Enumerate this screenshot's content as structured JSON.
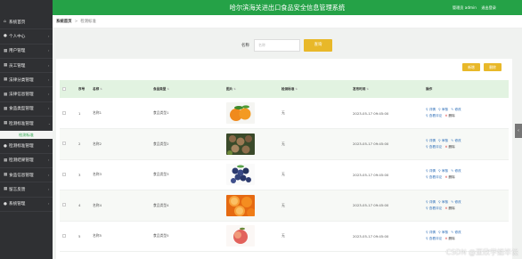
{
  "app": {
    "title": "哈尔滨海关进出口食品安全信息管理系统"
  },
  "topbar": {
    "user_label": "管理员 admin",
    "logout_label": "退出登录"
  },
  "sidebar": {
    "items": [
      {
        "icon": "home-icon",
        "glyph": "⌂",
        "label": "系统首页",
        "chevron": ""
      },
      {
        "icon": "user-icon",
        "glyph": "●",
        "label": "个人中心",
        "chevron": "›"
      },
      {
        "icon": "grid-icon",
        "glyph": "▦",
        "label": "用户管理",
        "chevron": "›"
      },
      {
        "icon": "grid-icon",
        "glyph": "▦",
        "label": "员工管理",
        "chevron": "›"
      },
      {
        "icon": "grid-icon",
        "glyph": "▦",
        "label": "法律分类管理",
        "chevron": "›"
      },
      {
        "icon": "grid-icon",
        "glyph": "▦",
        "label": "法律信息管理",
        "chevron": "›"
      },
      {
        "icon": "grid-icon",
        "glyph": "▦",
        "label": "食品类型管理",
        "chevron": "›"
      },
      {
        "icon": "grid-icon",
        "glyph": "▦",
        "label": "检测标准管理",
        "chevron": "⌄"
      }
    ],
    "sub_item": "检测标准",
    "items_after": [
      {
        "icon": "bulb-icon",
        "glyph": "●",
        "label": "检测标准管理",
        "chevron": "›"
      },
      {
        "icon": "grid-icon",
        "glyph": "▦",
        "label": "检测结果管理",
        "chevron": "›"
      },
      {
        "icon": "grid-icon",
        "glyph": "▦",
        "label": "食品信息管理",
        "chevron": "›"
      },
      {
        "icon": "grid-icon",
        "glyph": "▦",
        "label": "留言反馈",
        "chevron": "›"
      },
      {
        "icon": "user-icon",
        "glyph": "●",
        "label": "系统管理",
        "chevron": "›"
      }
    ]
  },
  "breadcrumb": {
    "home": "系统首页",
    "separator": ">",
    "current": "检测标准"
  },
  "search": {
    "label": "名称",
    "placeholder": "名称",
    "button": "查询"
  },
  "toolbar": {
    "add_label": "新增",
    "delete_label": "删除"
  },
  "table": {
    "headers": [
      "序号",
      "名称",
      "食品类型",
      "图片",
      "检测标准",
      "发布时间",
      "操作"
    ],
    "rows": [
      {
        "index": "1",
        "name": "名称1",
        "type": "食品类型1",
        "image": "oranges",
        "standard": "无",
        "time": "2023-05-17 09:45:00"
      },
      {
        "index": "2",
        "name": "名称2",
        "type": "食品类型2",
        "image": "nuts",
        "standard": "无",
        "time": "2023-05-17 09:45:00"
      },
      {
        "index": "3",
        "name": "名称3",
        "type": "食品类型3",
        "image": "blueberries",
        "standard": "无",
        "time": "2023-05-17 09:45:00"
      },
      {
        "index": "4",
        "name": "名称4",
        "type": "食品类型4",
        "image": "orange-slices",
        "standard": "无",
        "time": "2023-05-17 09:45:00"
      },
      {
        "index": "5",
        "name": "名称5",
        "type": "食品类型5",
        "image": "peach",
        "standard": "无",
        "time": "2023-05-17 09:45:00"
      }
    ],
    "actions": {
      "detail": "详情",
      "check": "审核",
      "edit": "修改",
      "comment": "查看评论",
      "delete": "删除"
    }
  },
  "collapse_glyph": "‹",
  "watermark": "CSDN @亚欣学姐毕设"
}
